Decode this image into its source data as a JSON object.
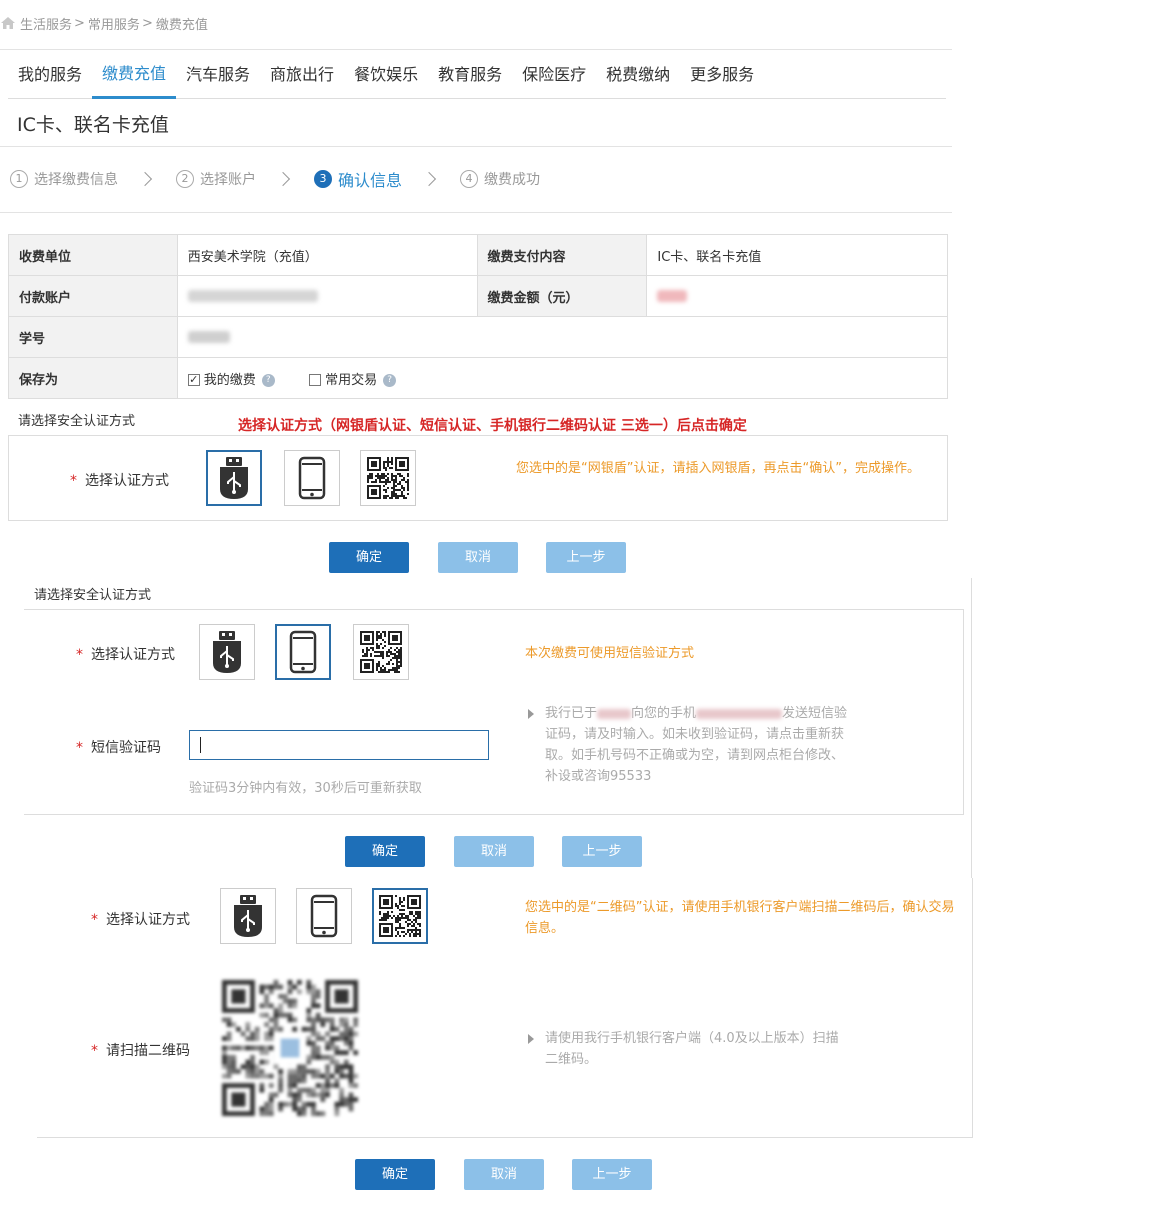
{
  "breadcrumb": {
    "items": [
      "生活服务",
      "常用服务",
      "缴费充值"
    ],
    "sep": ">"
  },
  "nav": {
    "tabs": [
      "我的服务",
      "缴费充值",
      "汽车服务",
      "商旅出行",
      "餐饮娱乐",
      "教育服务",
      "保险医疗",
      "税费缴纳",
      "更多服务"
    ],
    "active": 1
  },
  "page": {
    "title": "IC卡、联名卡充值"
  },
  "steps": [
    {
      "num": "1",
      "label": "选择缴费信息"
    },
    {
      "num": "2",
      "label": "选择账户"
    },
    {
      "num": "3",
      "label": "确认信息"
    },
    {
      "num": "4",
      "label": "缴费成功"
    }
  ],
  "info": {
    "payee_label": "收费单位",
    "payee_value": "西安美术学院（充值）",
    "content_label": "缴费支付内容",
    "content_value": "IC卡、联名卡充值",
    "account_label": "付款账户",
    "amount_label": "缴费金额（元）",
    "student_id_label": "学号",
    "save_as_label": "保存为",
    "opt_my_payment": "我的缴费",
    "opt_common_tx": "常用交易"
  },
  "section1": {
    "heading": "请选择安全认证方式",
    "instruction": "选择认证方式（网银盾认证、短信认证、手机银行二维码认证 三选一）后点击确定",
    "label": "选择认证方式",
    "tip": "您选中的是“网银盾”认证，请插入网银盾，再点击“确认”，完成操作。",
    "btn_ok": "确定",
    "btn_cancel": "取消",
    "btn_prev": "上一步"
  },
  "section2": {
    "heading": "请选择安全认证方式",
    "label": "选择认证方式",
    "tip": "本次缴费可使用短信验证方式",
    "sms_label": "短信验证码",
    "sms_value": "",
    "sms_hint": "验证码3分钟内有效，30秒后可重新获取",
    "note_a": "我行已于",
    "note_b": "向您的手机",
    "note_c": "发送短信验证码，请及时输入。如未收到验证码，请点击重新获取。如手机号码不正确或为空，请到网点柜台修改、补设或咨询95533",
    "btn_ok": "确定",
    "btn_cancel": "取消",
    "btn_prev": "上一步"
  },
  "section3": {
    "label": "选择认证方式",
    "tip": "您选中的是“二维码”认证，请使用手机银行客户端扫描二维码后，确认交易信息。",
    "scan_label": "请扫描二维码",
    "scan_note": "请使用我行手机银行客户端（4.0及以上版本）扫描二维码。",
    "btn_ok": "确定",
    "btn_cancel": "取消",
    "btn_prev": "上一步"
  },
  "icons": [
    "home-icon",
    "usb-key-icon",
    "phone-icon",
    "qr-code-icon",
    "help-icon",
    "checkbox-icon"
  ],
  "colors": {
    "accent": "#2d8ccc",
    "primary_button": "#1e6fb8",
    "light_button": "#8cc0e8",
    "warning_red": "#d62626",
    "tip_orange": "#ec9a2a"
  }
}
